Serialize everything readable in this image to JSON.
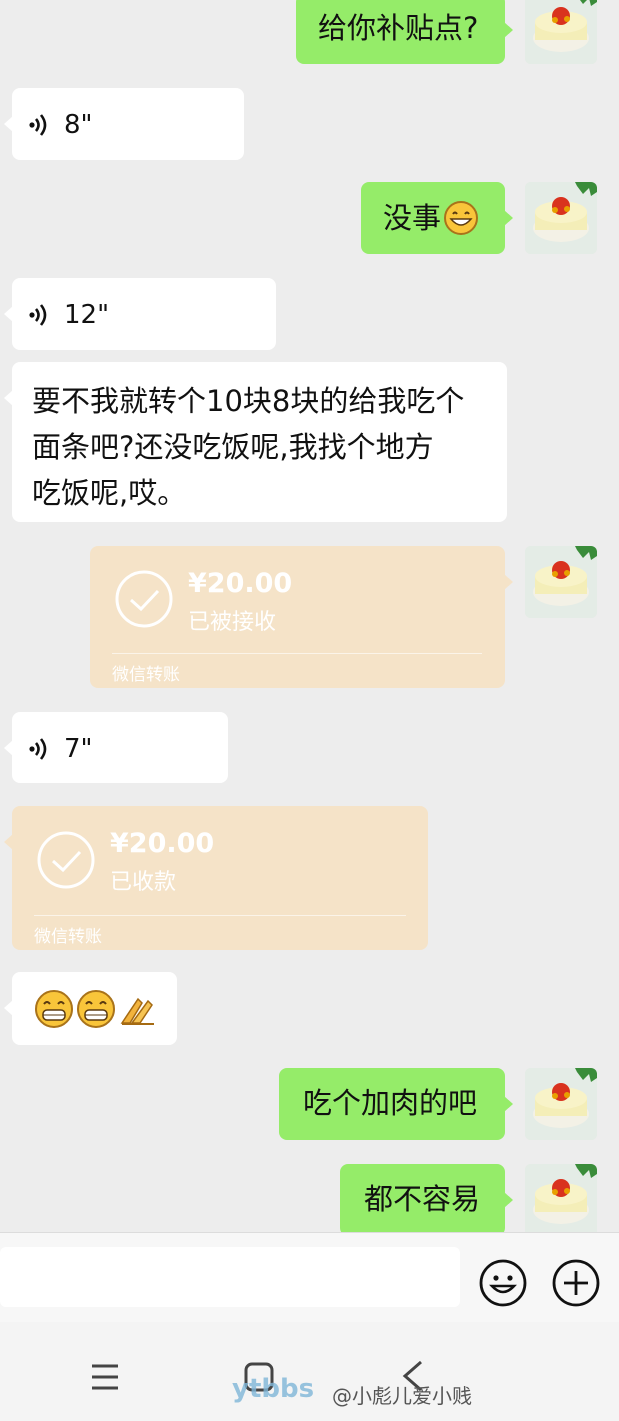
{
  "messages": {
    "m1_text": "给你补贴点?",
    "v1_duration": "8\"",
    "m2_text": "没事",
    "v2_duration": "12\"",
    "m3_line1": "要不我就转个10块8块的给我吃个",
    "m3_line2": "面条吧?还没吃饭呢,我找个地方",
    "m3_line3": "吃饭呢,哎。",
    "t1_amount": "¥20.00",
    "t1_status": "已被接收",
    "t1_footer": "微信转账",
    "v3_duration": "7\"",
    "t2_amount": "¥20.00",
    "t2_status": "已收款",
    "t2_footer": "微信转账",
    "m4_text": "吃个加肉的吧",
    "m5_text": "都不容易"
  },
  "input": {
    "placeholder": ""
  },
  "watermark": {
    "logo": "ytbbs",
    "handle": "@小彪儿爱小贱"
  },
  "colors": {
    "background": "#ededed",
    "outgoing_bubble": "#95ec69",
    "incoming_bubble": "#ffffff",
    "transfer_card": "#f5e3c8"
  },
  "icons": [
    "voice-icon",
    "check-circle-icon",
    "grin-emoji-icon",
    "clap-emoji-icon",
    "smile-emoji-icon",
    "plus-icon",
    "menu-icon",
    "home-icon",
    "back-icon"
  ]
}
